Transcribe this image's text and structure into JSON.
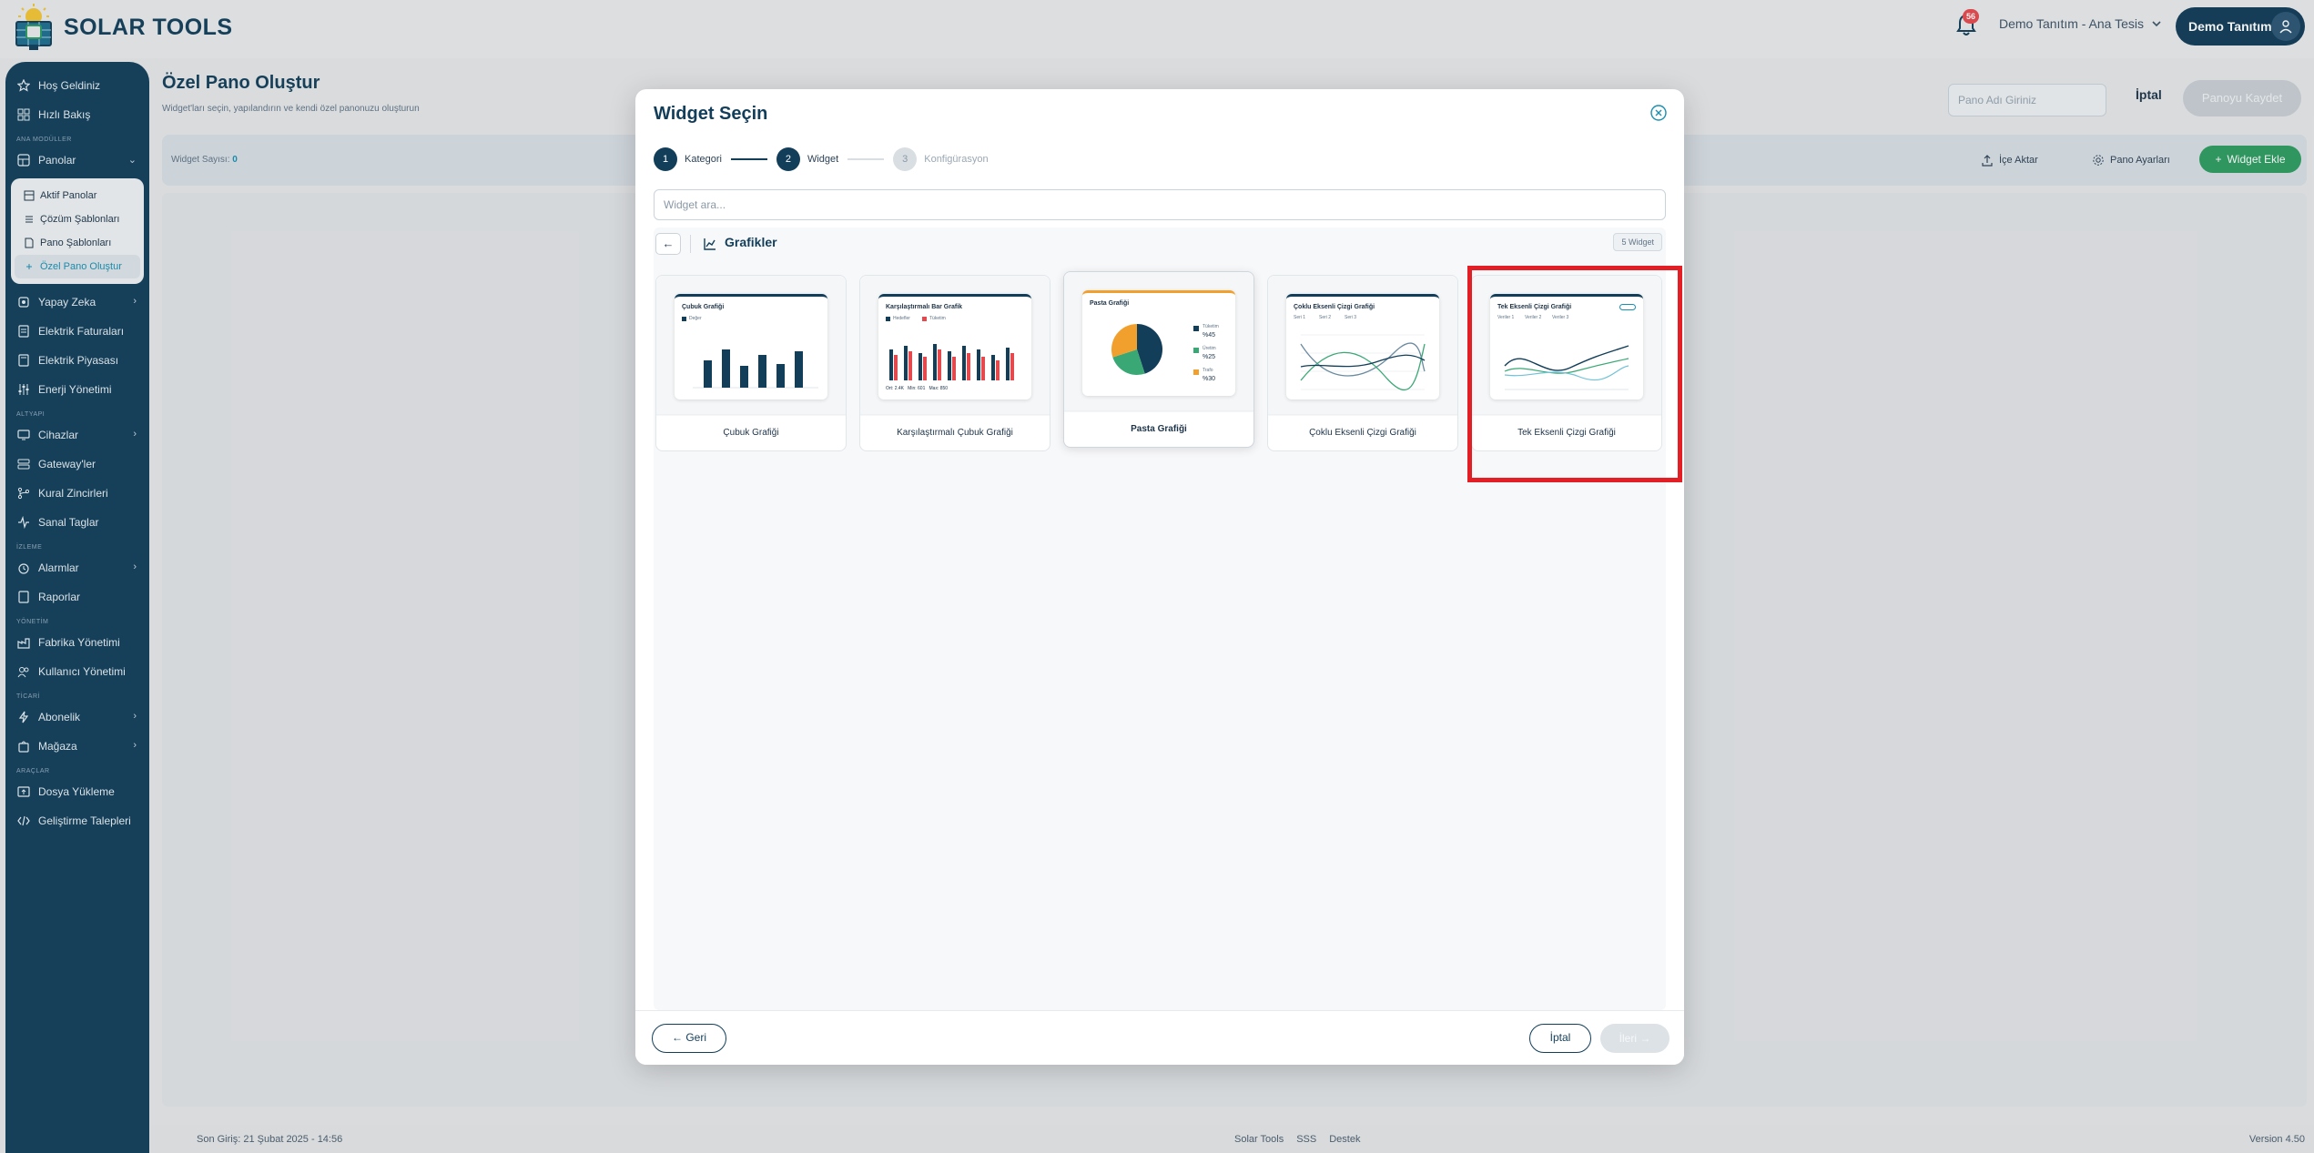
{
  "app": {
    "name": "SOLAR TOOLS"
  },
  "header": {
    "notifications_badge": "56",
    "tenant_label": "Demo Tanıtım - Ana Tesis",
    "user_name": "Demo Tanıtım"
  },
  "sidebar": {
    "top_items": [
      {
        "label": "Hoş Geldiniz",
        "icon": "star-icon"
      },
      {
        "label": "Hızlı Bakış",
        "icon": "grid-icon"
      }
    ],
    "sections": {
      "main_modules": "ANA MODÜLLER",
      "infrastructure": "ALTYAPI",
      "monitoring": "İZLEME",
      "management": "YÖNETİM",
      "commerce": "TİCARİ",
      "tools": "ARAÇLAR"
    },
    "panels": {
      "label": "Panolar",
      "sub_items": [
        {
          "label": "Aktif Panolar"
        },
        {
          "label": "Çözüm Şablonları"
        },
        {
          "label": "Pano Şablonları"
        },
        {
          "label": "Özel Pano Oluştur"
        }
      ]
    },
    "main_items": [
      {
        "label": "Yapay Zeka",
        "has_children": true
      },
      {
        "label": "Elektrik Faturaları",
        "has_children": false
      },
      {
        "label": "Elektrik Piyasası",
        "has_children": false
      },
      {
        "label": "Enerji Yönetimi",
        "has_children": false
      }
    ],
    "infra_items": [
      {
        "label": "Cihazlar",
        "has_children": true
      },
      {
        "label": "Gateway'ler",
        "has_children": false
      },
      {
        "label": "Kural Zincirleri",
        "has_children": false
      },
      {
        "label": "Sanal Taglar",
        "has_children": false
      }
    ],
    "monitoring_items": [
      {
        "label": "Alarmlar",
        "has_children": true
      },
      {
        "label": "Raporlar",
        "has_children": false
      }
    ],
    "management_items": [
      {
        "label": "Fabrika Yönetimi"
      },
      {
        "label": "Kullanıcı Yönetimi"
      }
    ],
    "commerce_items": [
      {
        "label": "Abonelik",
        "has_children": true
      },
      {
        "label": "Mağaza",
        "has_children": true
      }
    ],
    "tools_items": [
      {
        "label": "Dosya Yükleme"
      },
      {
        "label": "Geliştirme Talepleri"
      }
    ]
  },
  "page": {
    "title": "Özel Pano Oluştur",
    "subtitle": "Widget'ları seçin, yapılandırın ve kendi özel panonuzu oluşturun",
    "board_name_placeholder": "Pano Adı Giriniz",
    "cancel_label": "İptal",
    "save_label": "Panoyu Kaydet",
    "widget_count_label": "Widget Sayısı:",
    "widget_count_value": "0",
    "import_label": "İçe Aktar",
    "settings_label": "Pano Ayarları",
    "add_widget_label": "Widget Ekle"
  },
  "modal": {
    "title": "Widget Seçin",
    "steps": [
      {
        "num": "1",
        "label": "Kategori",
        "state": "done"
      },
      {
        "num": "2",
        "label": "Widget",
        "state": "active"
      },
      {
        "num": "3",
        "label": "Konfigürasyon",
        "state": "pending"
      }
    ],
    "search_placeholder": "Widget ara...",
    "category": {
      "name": "Grafikler",
      "count": "5 Widget"
    },
    "cards": [
      {
        "name": "Çubuk Grafiği",
        "preview_title": "Çubuk Grafiği",
        "preview_legend": "Değer",
        "selected": false
      },
      {
        "name": "Karşılaştırmalı Çubuk Grafiği",
        "preview_title": "Karşılaştırmalı Bar Grafik",
        "preview_legend": [
          "Hedefler",
          "Tüketim"
        ],
        "preview_stats": "Ort: 2.4K   Min: 601   Max: 850",
        "selected": false
      },
      {
        "name": "Pasta Grafiği",
        "preview_title": "Pasta Grafiği",
        "slices": [
          {
            "label": "Tüketim",
            "value": "%45",
            "color": "#123e5a"
          },
          {
            "label": "Üretim",
            "value": "%25",
            "color": "#3aa875"
          },
          {
            "label": "Trafo",
            "value": "%30",
            "color": "#f2a02d"
          }
        ],
        "selected": true
      },
      {
        "name": "Çoklu Eksenli Çizgi Grafiği",
        "preview_title": "Çoklu Eksenli Çizgi Grafiği",
        "preview_legend": [
          "Seri 1",
          "Seri 2",
          "Seri 3"
        ],
        "selected": false
      },
      {
        "name": "Tek Eksenli Çizgi Grafiği",
        "preview_title": "Tek Eksenli Çizgi Grafiği",
        "preview_legend": [
          "Veriler 1",
          "Veriler 2",
          "Veriler 3"
        ],
        "selected": false
      }
    ],
    "back_label": "← Geri",
    "cancel_label": "İptal",
    "next_label": "İleri →"
  },
  "footer": {
    "last_login": "Son Giriş: 21 Şubat 2025 - 14:56",
    "links": [
      "Solar Tools",
      "SSS",
      "Destek"
    ],
    "version": "Version 4.50"
  },
  "colors": {
    "primary": "#123e5a",
    "accent": "#1b8fb0",
    "success": "#2e9c61",
    "highlight": "#e31e24"
  }
}
